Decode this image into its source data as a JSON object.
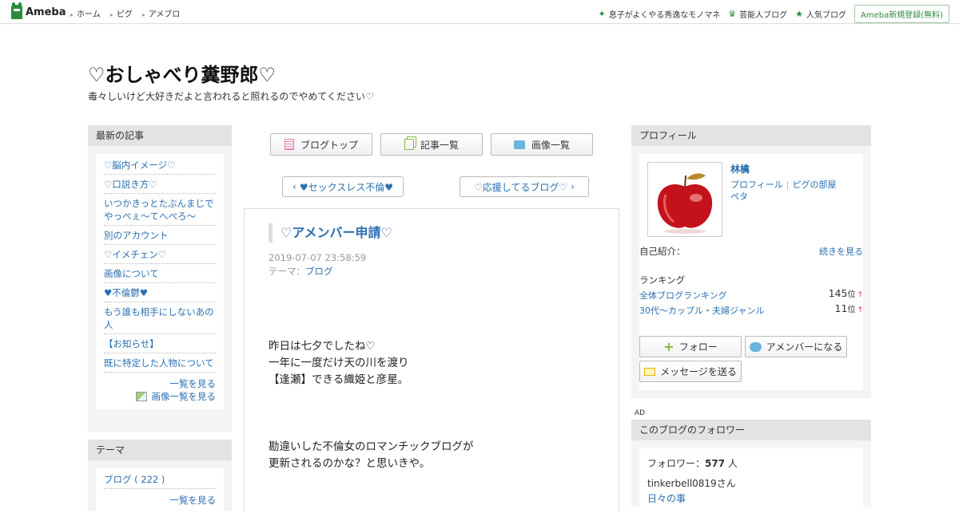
{
  "header": {
    "logo": "Ameba",
    "nav": [
      "ホーム",
      "ピグ",
      "アメブロ"
    ],
    "right_links": [
      {
        "label": "息子がよくやる秀逸なモノマネ",
        "icon": "sparkle-icon"
      },
      {
        "label": "芸能人ブログ",
        "icon": "crown-icon"
      },
      {
        "label": "人気ブログ",
        "icon": "star-icon"
      }
    ],
    "signup": "Ameba新規登録(無料)"
  },
  "blog": {
    "title": "♡おしゃべり糞野郎♡",
    "description": "毒々しいけど大好きだよと言われると照れるのでやめてください♡"
  },
  "left": {
    "recent_title": "最新の記事",
    "recent": [
      "♡脳内イメージ♡",
      "♡口説き方♡",
      "いつかきっとたぶんまじでやっぺぇ～てへぺろ～",
      "別のアカウント",
      "♡イメチェン♡",
      "画像について",
      "♥不倫鬱♥",
      "もう誰も相手にしないあの人",
      "【お知らせ】",
      "既に特定した人物について"
    ],
    "list_more": "一覧を見る",
    "image_more": "画像一覧を見る",
    "theme_title": "テーマ",
    "themes": [
      "ブログ ( 222 )"
    ],
    "theme_more": "一覧を見る"
  },
  "center": {
    "buttons": [
      "ブログトップ",
      "記事一覧",
      "画像一覧"
    ],
    "prev": "♥セックスレス不倫♥",
    "next": "♡応援してるブログ♡",
    "article": {
      "title": "♡アメンバー申請♡",
      "date": "2019-07-07 23:58:59",
      "theme_label": "テーマ：",
      "theme": "ブログ",
      "para1": [
        "昨日は七夕でしたね♡",
        "一年に一度だけ天の川を渡り",
        "【逢瀬】できる織姫と彦星。"
      ],
      "para2": [
        "勘違いした不倫女のロマンチックブログが",
        "更新されるのかな？と思いきや。"
      ]
    }
  },
  "right": {
    "profile_title": "プロフィール",
    "name": "林檎",
    "link_profile": "プロフィール",
    "link_pigg": "ピグの部屋",
    "link_peta": "ペタ",
    "intro_label": "自己紹介：",
    "intro_more": "続きを見る",
    "ranking_label": "ランキング",
    "rankings": [
      {
        "name": "全体ブログランキング",
        "value": "145",
        "unit": "位",
        "arrow": "↑"
      },
      {
        "name": "30代〜カップル・夫婦ジャンル",
        "value": "11",
        "unit": "位",
        "arrow": "↑"
      }
    ],
    "follow": "フォロー",
    "amember": "アメンバーになる",
    "message": "メッセージを送る",
    "ad": "AD",
    "followers_title": "このブログのフォロワー",
    "followers_label": "フォロワー：",
    "followers_count": "577",
    "followers_unit": "人",
    "follower_name": "tinkerbell0819さん",
    "follower_blog": "日々の事"
  },
  "colors": {
    "link": "#2a6fb0",
    "brand": "#2d8c3c",
    "panel": "#f4f4f4",
    "panel_head": "#e3e3e3"
  }
}
